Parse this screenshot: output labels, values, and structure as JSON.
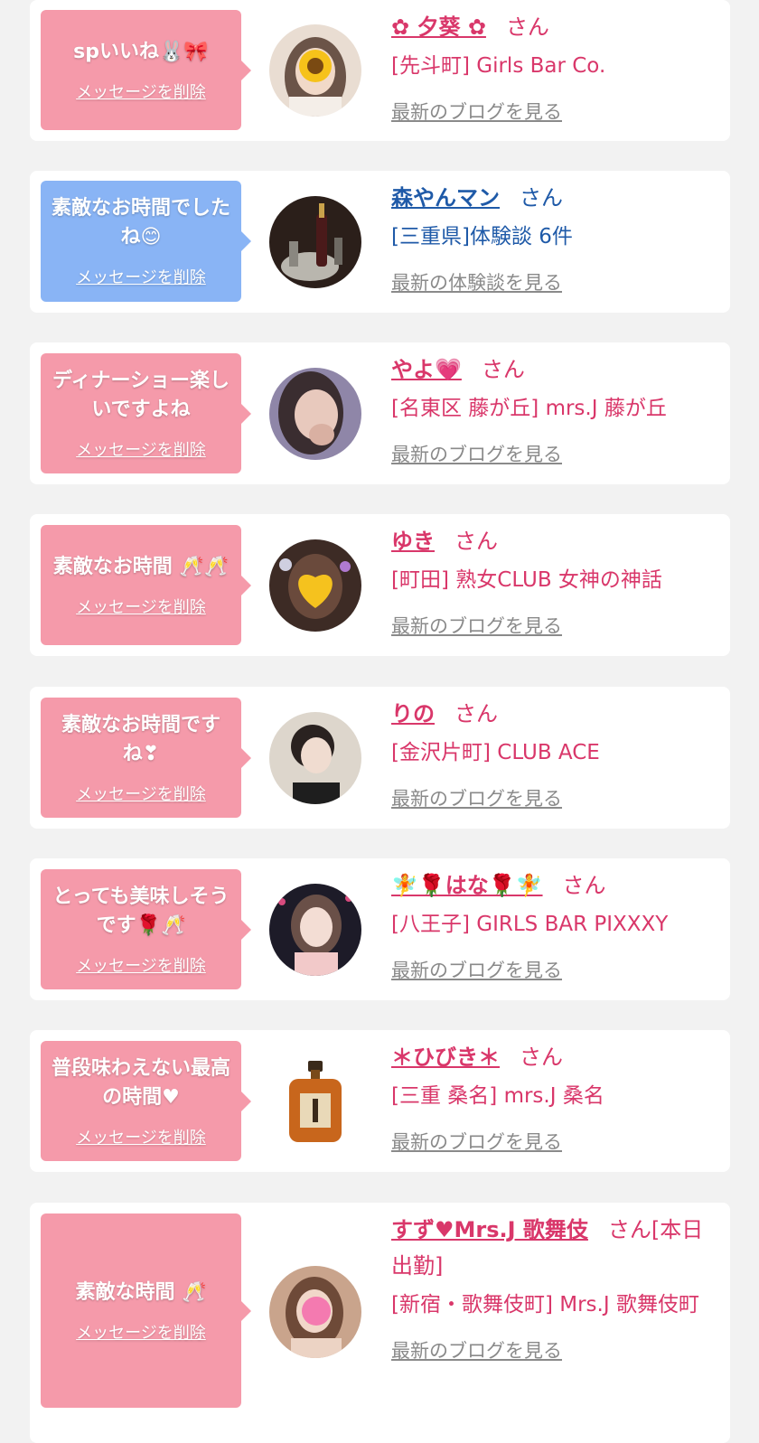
{
  "cards": [
    {
      "bubble": {
        "message": "spいいね🐰🎀",
        "delete_label": "メッセージを削除"
      },
      "name": "✿ 夕葵 ✿",
      "honorific": "さん",
      "shop": "[先斗町] Girls Bar Co.",
      "link": "最新のブログを見る"
    },
    {
      "bubble": {
        "message": "素敵なお時間でしたね😊",
        "delete_label": "メッセージを削除"
      },
      "name": "森やんマン",
      "honorific": "さん",
      "shop": "[三重県]体験談 6件",
      "link": "最新の体験談を見る"
    },
    {
      "bubble": {
        "message": "ディナーショー楽しいですよね",
        "delete_label": "メッセージを削除"
      },
      "name": "やよ💗",
      "honorific": "さん",
      "shop": "[名東区 藤が丘] mrs.J 藤が丘",
      "link": "最新のブログを見る"
    },
    {
      "bubble": {
        "message": "素敵なお時間 🥂🥂",
        "delete_label": "メッセージを削除"
      },
      "name": "ゆき",
      "honorific": "さん",
      "shop": "[町田] 熟女CLUB 女神の神話",
      "link": "最新のブログを見る"
    },
    {
      "bubble": {
        "message": "素敵なお時間ですね❣",
        "delete_label": "メッセージを削除"
      },
      "name": "りの",
      "honorific": "さん",
      "shop": "[金沢片町] CLUB ACE",
      "link": "最新のブログを見る"
    },
    {
      "bubble": {
        "message": "とっても美味しそうです🌹🥂",
        "delete_label": "メッセージを削除"
      },
      "name": "🧚🌹はな🌹🧚",
      "honorific": "さん",
      "shop": "[八王子] GIRLS BAR PIXXXY",
      "link": "最新のブログを見る"
    },
    {
      "bubble": {
        "message": "普段味わえない最高の時間♥",
        "delete_label": "メッセージを削除"
      },
      "name": "＊ひびき＊",
      "honorific": "さん",
      "shop": "[三重 桑名] mrs.J 桑名",
      "link": "最新のブログを見る"
    },
    {
      "bubble": {
        "message": "素敵な時間 🥂",
        "delete_label": "メッセージを削除"
      },
      "name": "すず♥Mrs.J 歌舞伎",
      "honorific": "さん[本日出勤]",
      "shop": "[新宿・歌舞伎町] Mrs.J 歌舞伎町",
      "link": "最新のブログを見る"
    }
  ],
  "colors": {
    "background": "#f2f2f2",
    "card": "#ffffff",
    "bubble_pink": "#f59aaa",
    "bubble_blue": "#89b4f5",
    "text_pink": "#d9376a",
    "text_blue": "#1f5aa8",
    "link_gray": "#8a8a8a"
  }
}
